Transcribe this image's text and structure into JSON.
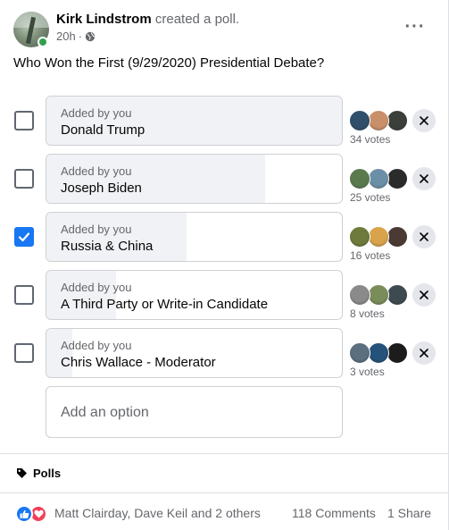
{
  "post": {
    "author": "Kirk Lindstrom",
    "action": "created a poll.",
    "time": "20h",
    "privacy_icon": "globe-icon",
    "more_icon": "more-options-icon",
    "question": "Who Won the First (9/29/2020) Presidential Debate?"
  },
  "poll": {
    "options": [
      {
        "added_by": "Added by you",
        "label": "Donald Trump",
        "votes_text": "34 votes",
        "votes": 34,
        "checked": false,
        "voter_colors": [
          "#2f4f6b",
          "#c98f6a",
          "#3a3f3a"
        ]
      },
      {
        "added_by": "Added by you",
        "label": "Joseph Biden",
        "votes_text": "25 votes",
        "votes": 25,
        "checked": false,
        "voter_colors": [
          "#5a7a4e",
          "#6c8fa8",
          "#2b2b2b"
        ]
      },
      {
        "added_by": "Added by you",
        "label": "Russia & China",
        "votes_text": "16 votes",
        "votes": 16,
        "checked": true,
        "voter_colors": [
          "#6d7a3c",
          "#d8a34a",
          "#4a3a33"
        ]
      },
      {
        "added_by": "Added by you",
        "label": "A Third Party or Write-in Candidate",
        "votes_text": "8 votes",
        "votes": 8,
        "checked": false,
        "voter_colors": [
          "#8a8a8a",
          "#7a8c5a",
          "#3d4a50"
        ]
      },
      {
        "added_by": "Added by you",
        "label": "Chris Wallace - Moderator",
        "votes_text": "3 votes",
        "votes": 3,
        "checked": false,
        "voter_colors": [
          "#5b6f7e",
          "#24527a",
          "#1c1c1c"
        ]
      }
    ],
    "add_option_placeholder": "Add an option"
  },
  "tag": {
    "label": "Polls",
    "icon": "tag-icon"
  },
  "footer": {
    "reactions": [
      "like-icon",
      "love-icon"
    ],
    "reaction_names": "Matt Clairday, Dave Keil and 2 others",
    "comments": "118 Comments",
    "shares": "1 Share"
  },
  "colors": {
    "accent": "#1877f2",
    "online": "#31a24c",
    "bar_fill": "#f0f2f5",
    "secondary_text": "#65676b"
  }
}
